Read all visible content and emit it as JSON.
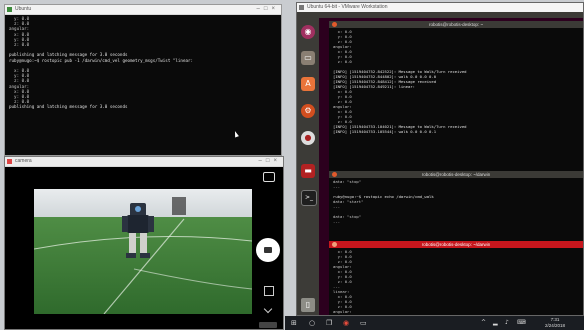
{
  "terminal_top": {
    "title": "Ubuntu",
    "lines": [
      "  y: 0.0",
      "  z: 0.0",
      "angular:",
      "  x: 0.0",
      "  y: 0.0",
      "  z: 0.0",
      "",
      "publishing and latching message for 3.0 seconds",
      "ruby@nugo:~$ rostopic pub -1 /darwin/cmd_vel geometry_msgs/Twist \"linear:",
      "",
      "  x: 0.0",
      "  y: 0.0",
      "  z: 0.0",
      "angular:",
      "  x: 0.0",
      "  y: 0.0",
      "  z: 0.0",
      "publishing and latching message for 3.0 seconds"
    ]
  },
  "camera_window": {
    "title": "camera"
  },
  "phone_ui": {
    "shutter_icon": "camera-shutter-icon",
    "mode_icon": "camera-mode-icon",
    "flip_icon": "switch-camera-icon",
    "chevron_icon": "chevron-down-icon"
  },
  "ubuntu_vm": {
    "title": "Ubuntu 64-bit - VMware Workstation",
    "launcher_icons": [
      "ubuntu-dash-icon",
      "files-icon",
      "software-center-icon",
      "settings-icon",
      "rviz-icon",
      "app-icon",
      "terminal-icon",
      "trash-icon"
    ],
    "term1": {
      "title": "robotis@robotis-desktop: ~",
      "lines": [
        "  x: 0.0",
        "  y: 0.0",
        "  z: 0.0",
        "angular:",
        "  x: 0.0",
        "  y: 0.0",
        "  z: 0.0",
        "",
        "[INFO] [1519404752.842522]: Message to Walk/Turn received",
        "[INFO] [1519404752.844802]: walk 0.0 0.0 0.0",
        "[INFO] [1519404752.848412]: Message received",
        "[INFO] [1519404752.849211]: linear:",
        "  x: 0.0",
        "  y: 0.0",
        "  z: 0.0",
        "angular:",
        "  x: 0.0",
        "  y: 0.0",
        "  z: 0.0",
        "[INFO] [1519404753.104021]: Message to Walk/Turn received",
        "[INFO] [1519404753.105544]: walk 0.0 0.0 0.1"
      ]
    },
    "term2": {
      "title": "robotis@robotis-desktop: ~/darwin",
      "lines": [
        "data: \"stop\"",
        "---",
        "",
        "ruby@nugo:~$ rostopic echo /darwin/cmd_walk",
        "data: \"start\"",
        "---",
        "",
        "data: \"stop\"",
        "---"
      ]
    },
    "term3": {
      "title": "robotis@robotis-desktop: ~/darwin",
      "lines": [
        "  x: 0.0",
        "  y: 0.0",
        "  z: 0.0",
        "angular:",
        "  x: 0.0",
        "  y: 0.0",
        "  z: 0.0",
        "---",
        "linear:",
        "  x: 0.0",
        "  y: 0.0",
        "  z: 0.0",
        "angular:",
        "  x: 0.0"
      ]
    }
  },
  "taskbar": {
    "time": "7:31",
    "date": "2/24/2018",
    "icons": [
      "windows-start-icon",
      "search-icon",
      "task-view-icon",
      "chrome-icon",
      "terminal-icon"
    ],
    "tray_icons": [
      "chevron-up-icon",
      "network-icon",
      "volume-icon",
      "keyboard-icon"
    ]
  },
  "colors": {
    "ubuntu_red": "#c7161d",
    "launcher_bg": "#3c3b37",
    "terminal_bg": "#0a0a0a",
    "field_green": "#3f7b38"
  }
}
